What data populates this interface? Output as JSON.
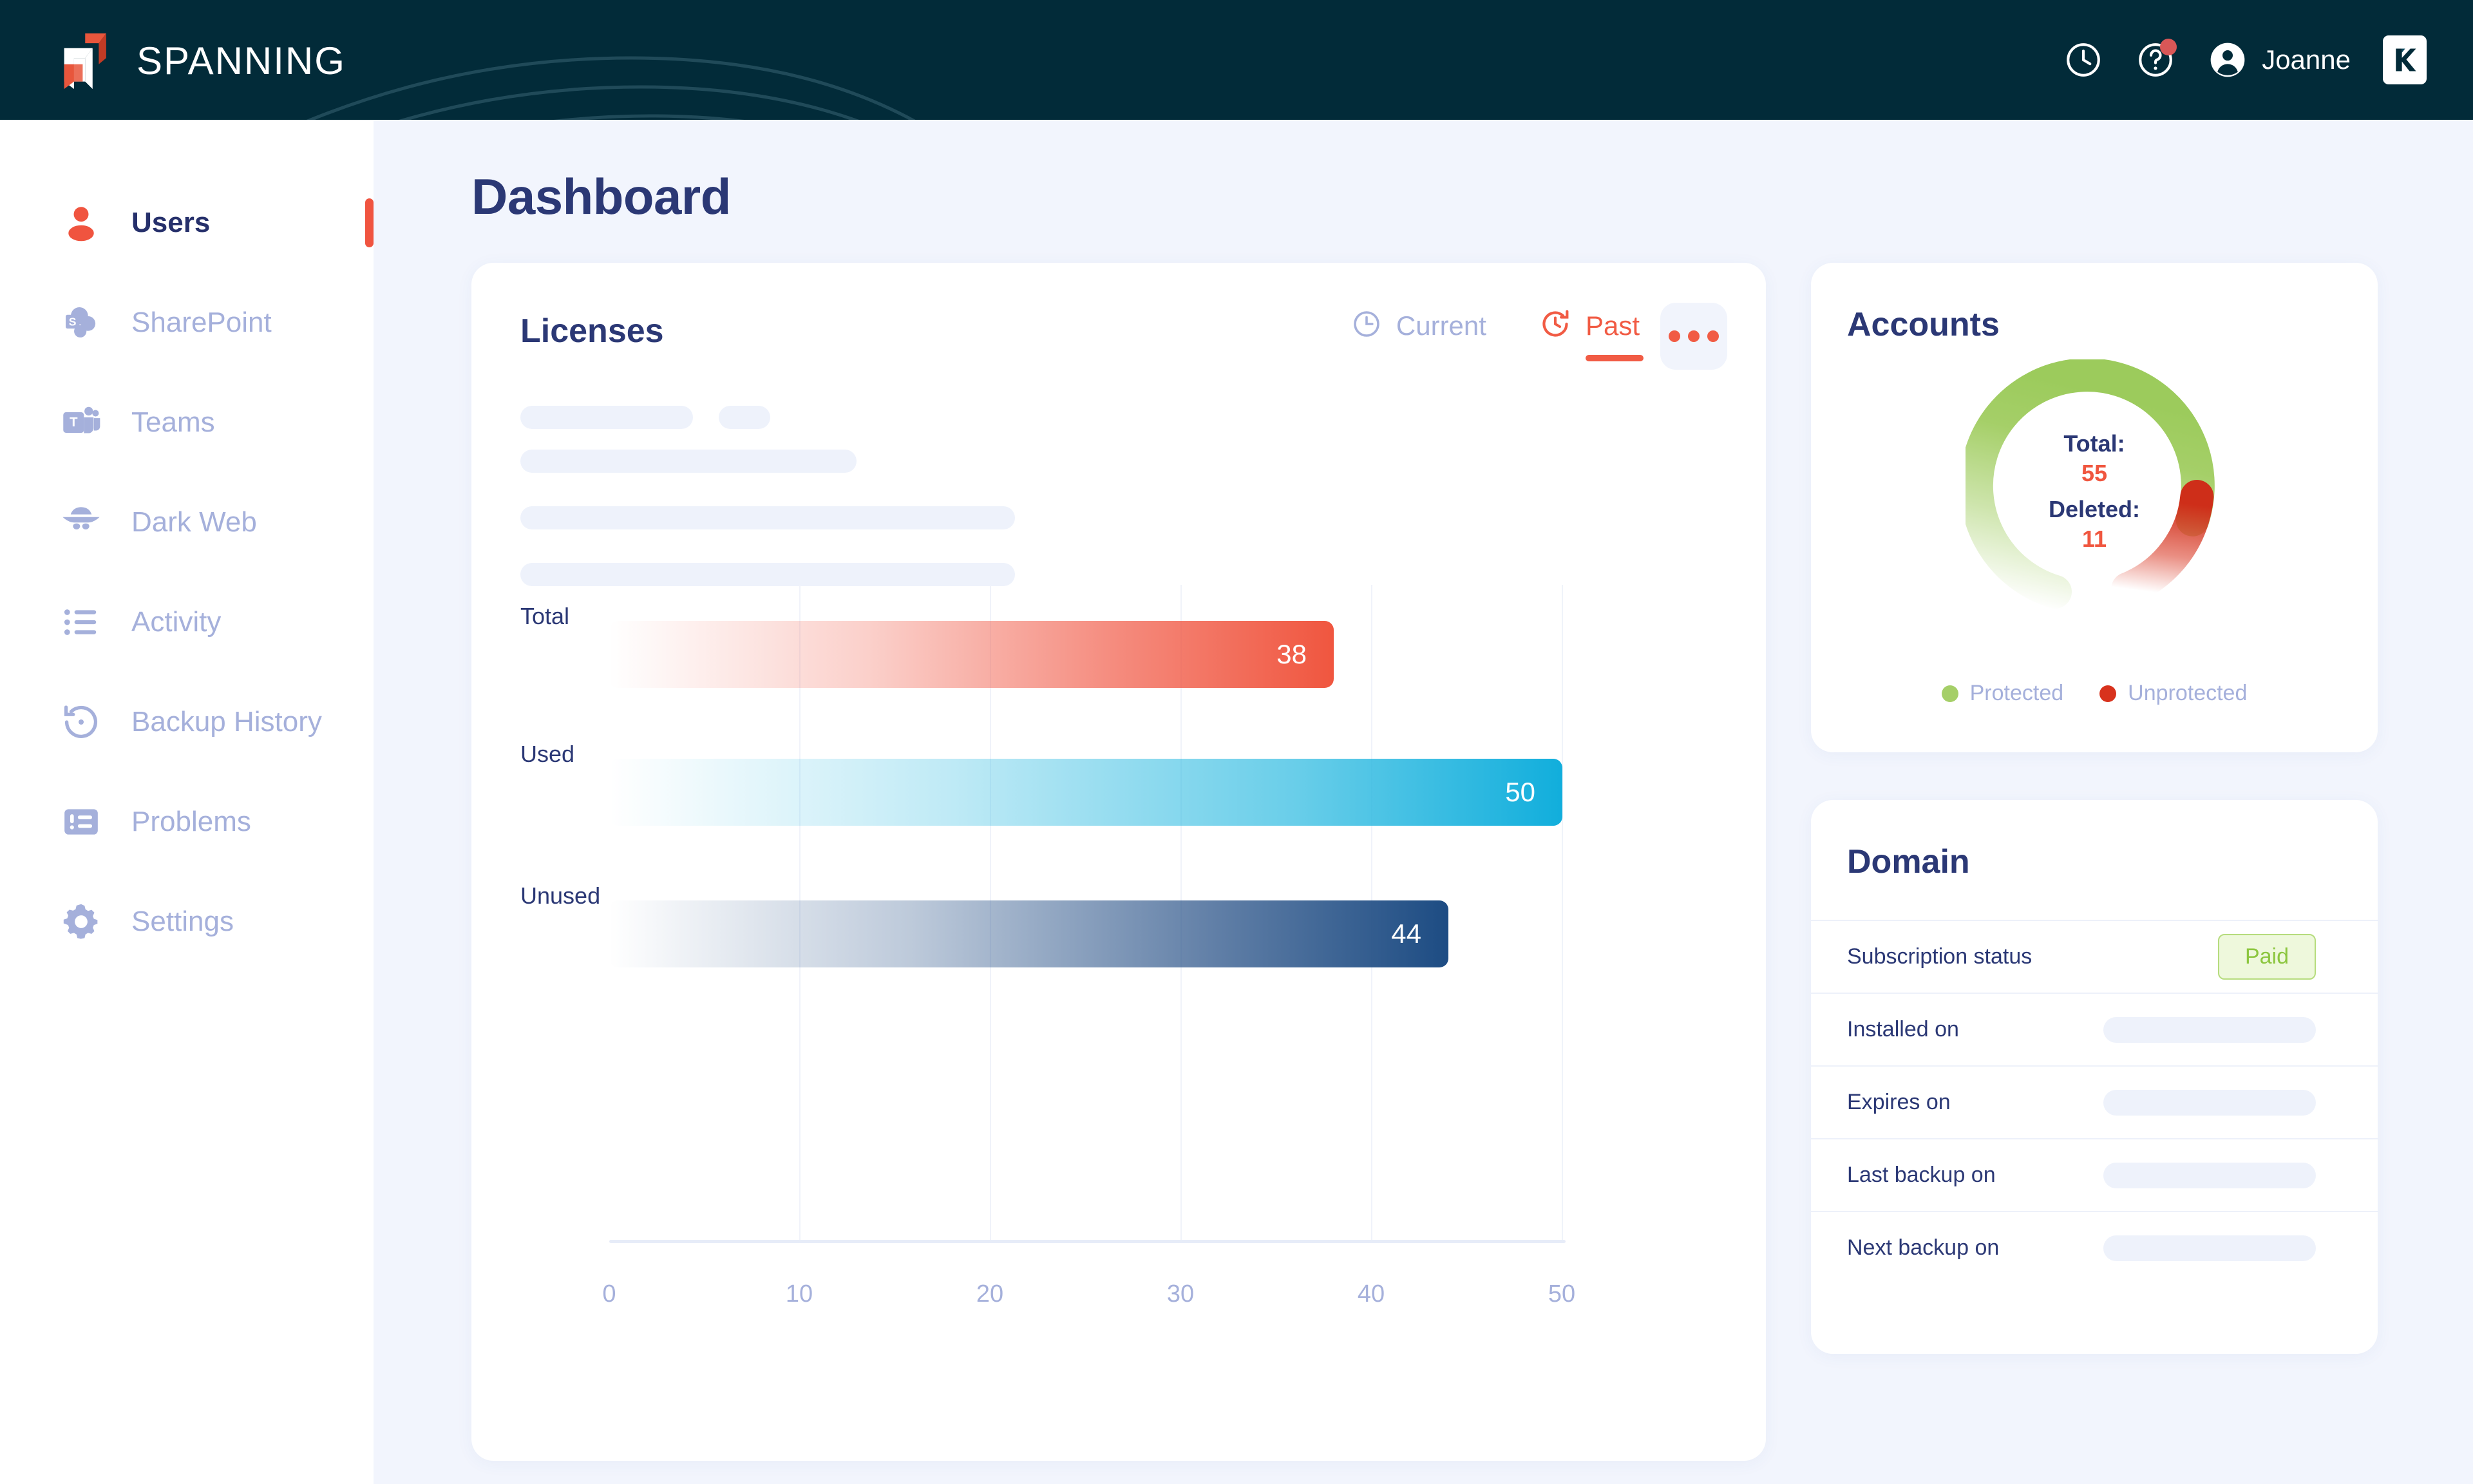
{
  "brand": {
    "name": "SPANNING"
  },
  "topbar": {
    "history_icon": "clock-icon",
    "help_icon": "help-circle-icon",
    "user_name": "Joanne",
    "kaseya_logo": "kaseya-k-logo"
  },
  "sidebar": {
    "items": [
      {
        "label": "Users",
        "icon": "user-icon",
        "active": true
      },
      {
        "label": "SharePoint",
        "icon": "sharepoint-icon",
        "active": false
      },
      {
        "label": "Teams",
        "icon": "teams-icon",
        "active": false
      },
      {
        "label": "Dark Web",
        "icon": "dark-web-icon",
        "active": false
      },
      {
        "label": "Activity",
        "icon": "list-icon",
        "active": false
      },
      {
        "label": "Backup History",
        "icon": "restore-clock-icon",
        "active": false
      },
      {
        "label": "Problems",
        "icon": "alert-panel-icon",
        "active": false
      },
      {
        "label": "Settings",
        "icon": "gear-icon",
        "active": false
      }
    ]
  },
  "page": {
    "title": "Dashboard"
  },
  "licenses": {
    "title": "Licenses",
    "tabs": [
      {
        "label": "Current",
        "icon": "clock-icon",
        "active": false
      },
      {
        "label": "Past",
        "icon": "clock-rotate-icon",
        "active": true
      }
    ],
    "more_menu": "ellipsis-icon"
  },
  "accounts": {
    "title": "Accounts",
    "center": {
      "total_label": "Total:",
      "total_value": "55",
      "deleted_label": "Deleted:",
      "deleted_value": "11"
    },
    "legend": [
      {
        "label": "Protected",
        "color": "#A5CF68"
      },
      {
        "label": "Unprotected",
        "color": "#D8321D"
      }
    ]
  },
  "domain": {
    "title": "Domain",
    "rows": [
      {
        "key": "Subscription status",
        "badge": "Paid",
        "value": null
      },
      {
        "key": "Installed on",
        "badge": null,
        "value": null
      },
      {
        "key": "Expires on",
        "badge": null,
        "value": null
      },
      {
        "key": "Last backup on",
        "badge": null,
        "value": null
      },
      {
        "key": "Next backup on",
        "badge": null,
        "value": null
      }
    ]
  },
  "colors": {
    "header_bg": "#022B39",
    "accent_orange": "#F05440",
    "navy": "#2B3875",
    "muted": "#A5B0DB",
    "page_bg": "#F2F5FD",
    "green": "#A5CF68",
    "red": "#D8321D",
    "cyan": "#11AEDC",
    "blue": "#1D4C83",
    "paid_green": "#8CC63F"
  },
  "chart_data": {
    "type": "bar",
    "orientation": "horizontal",
    "title": "Licenses",
    "categories": [
      "Total",
      "Used",
      "Unused"
    ],
    "values": [
      38,
      50,
      44
    ],
    "series": [
      {
        "name": "Licenses",
        "values": [
          38,
          50,
          44
        ]
      }
    ],
    "colors": [
      "#F0563F",
      "#11AEDC",
      "#1D4C83"
    ],
    "xlabel": "",
    "ylabel": "",
    "xlim": [
      0,
      50
    ],
    "xticks": [
      0,
      10,
      20,
      30,
      40,
      50
    ],
    "xticklabels": [
      "0",
      "10",
      "20",
      "30",
      "40",
      "50"
    ],
    "grid": true,
    "legend": false,
    "data_labels": [
      "38",
      "50",
      "44"
    ]
  },
  "donut_data": {
    "type": "pie",
    "variant": "donut",
    "labels": [
      "Protected",
      "Unprotected"
    ],
    "values": [
      44,
      11
    ],
    "colors": [
      "#A5CF68",
      "#D8321D"
    ],
    "center_text": [
      "Total:",
      "55",
      "Deleted:",
      "11"
    ],
    "legend": "bottom"
  }
}
